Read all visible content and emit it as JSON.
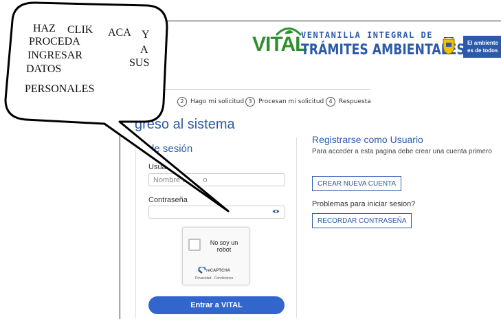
{
  "brand": {
    "logo_word": "VITAL",
    "line1": "VENTANILLA INTEGRAL DE",
    "line2": "TRÁMITES AMBIENTALES",
    "gov_badge_line1": "El ambiente",
    "gov_badge_line2": "es de todos"
  },
  "steps": [
    {
      "num": "2",
      "label": "Hago mi solicitud"
    },
    {
      "num": "3",
      "label": "Procesan mi solicitud"
    },
    {
      "num": "4",
      "label": "Respuesta"
    }
  ],
  "page_title": "greso al sistema",
  "login": {
    "title": "de sesión",
    "user_label": "Usuar",
    "user_placeholder": "Nombre u",
    "user_placeholder_tail": "o",
    "password_label": "Contraseña",
    "captcha_label": "No soy un robot",
    "captcha_brand": "reCAPTCHA",
    "captcha_links": "Privacidad - Condiciones",
    "submit": "Entrar a VITAL"
  },
  "register": {
    "title": "Registrarse como Usuario",
    "description": "Para acceder a esta pagina debe crear una cuenta primero",
    "create_button": "CREAR NUEVA CUENTA",
    "problems": "Problemas para iniciar sesion?",
    "recover_button": "RECORDAR CONTRASEÑA"
  },
  "callout": {
    "line1_a": "HAZ",
    "line1_b": "CLIK",
    "line1_c": "ACA",
    "line1_d": "Y",
    "line2_a": "PROCEDA",
    "line2_b": "A",
    "line3_a": "INGRESAR",
    "line3_b": "SUS",
    "line4": "DATOS",
    "line5": "PERSONALES"
  },
  "colors": {
    "accent": "#2c5aa8",
    "button": "#3366cc",
    "brand_green": "#2f8f2f"
  }
}
